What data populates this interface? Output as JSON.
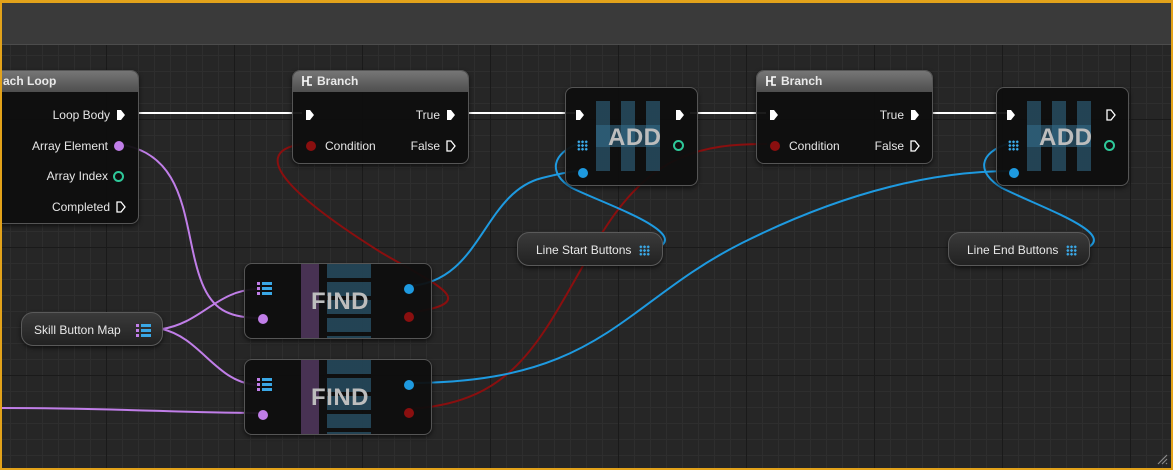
{
  "colors": {
    "frame_border": "#e2a21a",
    "exec_wire": "#ffffff",
    "bool_wire": "#8a0f0f",
    "array_wire": "#1e9ae0",
    "object_wire": "#c07ee8",
    "int_pin": "#2ec99a"
  },
  "loop_node": {
    "title": "ach Loop",
    "pins": {
      "loop_body": "Loop Body",
      "array_element": "Array Element",
      "array_index": "Array Index",
      "completed": "Completed"
    }
  },
  "branch1": {
    "title": "Branch",
    "condition": "Condition",
    "true_label": "True",
    "false_label": "False"
  },
  "branch2": {
    "title": "Branch",
    "condition": "Condition",
    "true_label": "True",
    "false_label": "False"
  },
  "add1": {
    "title": "ADD"
  },
  "add2": {
    "title": "ADD"
  },
  "find1": {
    "title": "FIND"
  },
  "find2": {
    "title": "FIND"
  },
  "variables": {
    "skill_button_map": "Skill Button Map",
    "line_start_buttons": "Line Start Buttons",
    "line_end_buttons": "Line End Buttons"
  }
}
